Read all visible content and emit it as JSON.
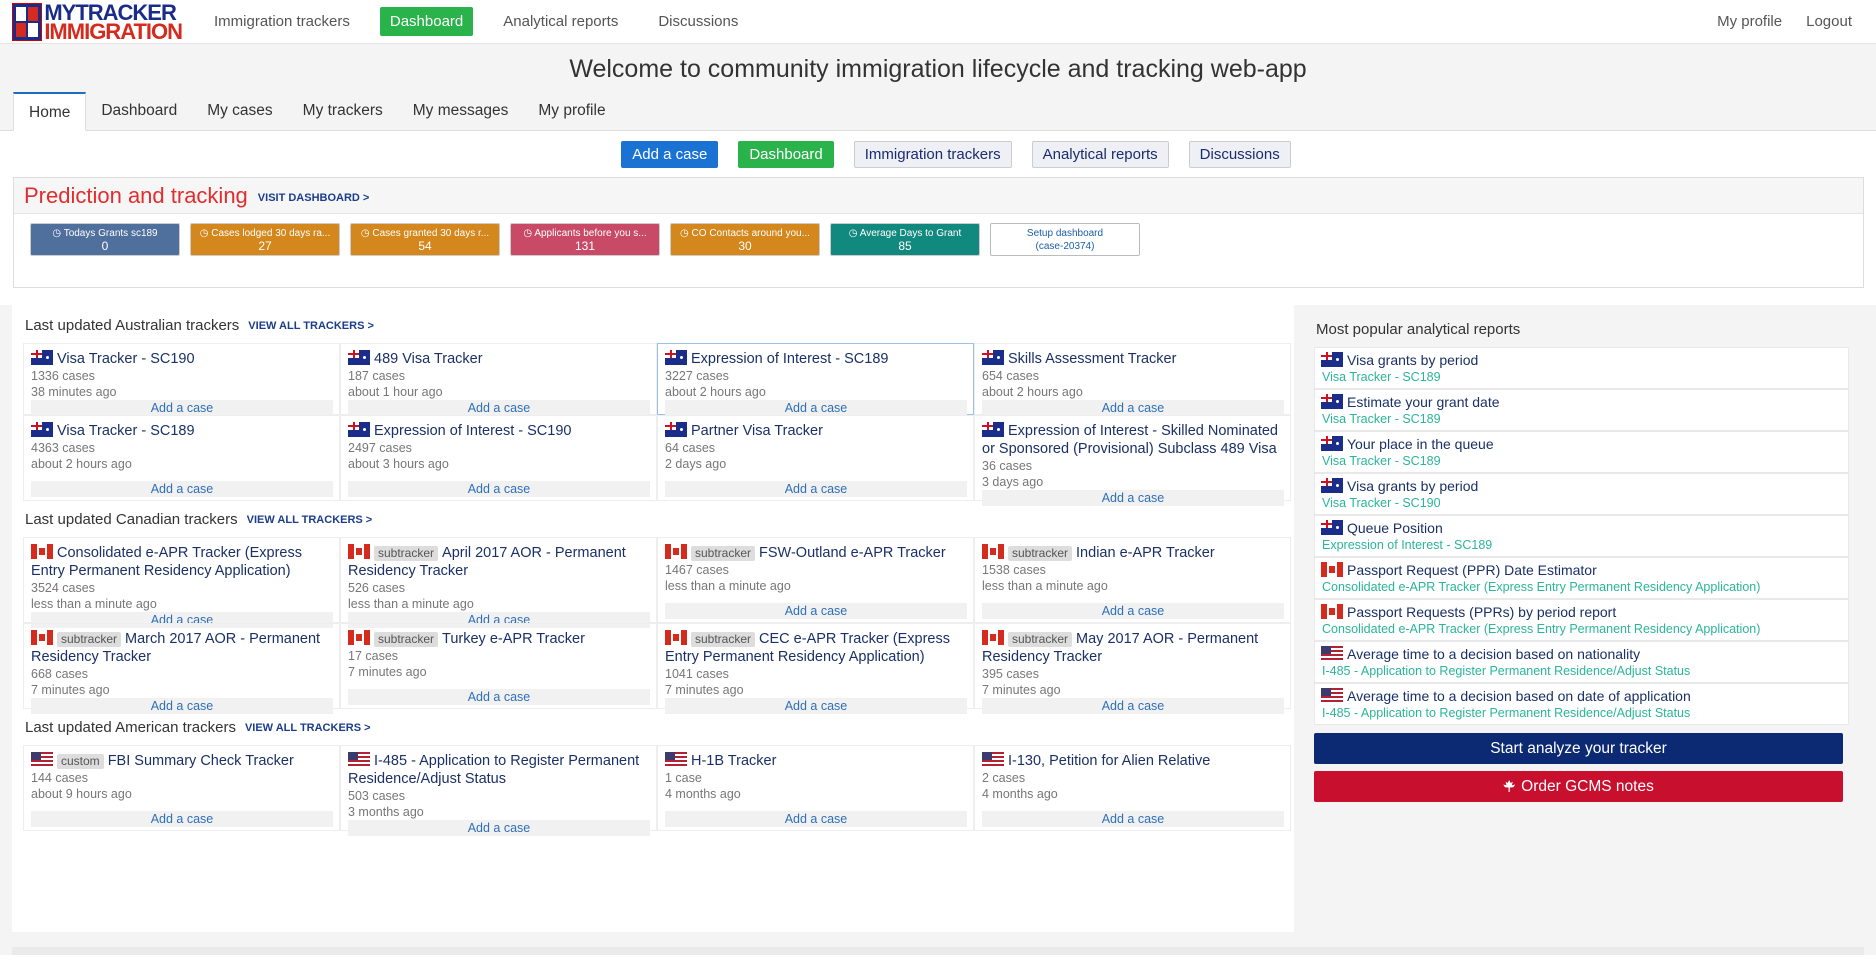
{
  "logo": {
    "line1": "MYTRACKER",
    "line2": "IMMIGRATION"
  },
  "topnav": {
    "items": [
      "Immigration trackers",
      "Dashboard",
      "Analytical reports",
      "Discussions"
    ],
    "active": 1,
    "right": [
      "My profile",
      "Logout"
    ]
  },
  "welcome": "Welcome to community immigration lifecycle and tracking web-app",
  "tabs": {
    "items": [
      "Home",
      "Dashboard",
      "My cases",
      "My trackers",
      "My messages",
      "My profile"
    ],
    "active": 0
  },
  "buttons": [
    "Add a case",
    "Dashboard",
    "Immigration trackers",
    "Analytical reports",
    "Discussions"
  ],
  "prediction": {
    "title": "Prediction and tracking",
    "visit": "VISIT DASHBOARD >",
    "stats": [
      {
        "label": "Todays Grants sc189",
        "value": "0",
        "icon": "clock-icon",
        "color": "#4f6f9d"
      },
      {
        "label": "Cases lodged 30 days ra...",
        "value": "27",
        "icon": "briefcase-icon",
        "color": "#d4871c"
      },
      {
        "label": "Cases granted 30 days r...",
        "value": "54",
        "icon": "briefcase-icon",
        "color": "#d4871c"
      },
      {
        "label": "Applicants before you s...",
        "value": "131",
        "icon": "people-icon",
        "color": "#c94a67"
      },
      {
        "label": "CO Contacts around you...",
        "value": "30",
        "icon": "briefcase-icon",
        "color": "#d4871c"
      },
      {
        "label": "Average Days to Grant",
        "value": "85",
        "icon": "globe-icon",
        "color": "#12897e"
      }
    ],
    "setup": {
      "line1": "Setup dashboard",
      "line2": "(case-20374)"
    }
  },
  "add_label": "Add a case",
  "view_all": "VIEW ALL TRACKERS >",
  "sections": [
    {
      "title": "Last updated Australian trackers",
      "cards": [
        {
          "flag": "au",
          "tag": "",
          "name": "Visa Tracker - SC190",
          "cases": "1336 cases",
          "time": "38 minutes ago"
        },
        {
          "flag": "au",
          "tag": "",
          "name": "489 Visa Tracker",
          "cases": "187 cases",
          "time": "about 1 hour ago"
        },
        {
          "flag": "au",
          "tag": "",
          "name": "Expression of Interest - SC189",
          "cases": "3227 cases",
          "time": "about 2 hours ago",
          "highlight": true
        },
        {
          "flag": "au",
          "tag": "",
          "name": "Skills Assessment Tracker",
          "cases": "654 cases",
          "time": "about 2 hours ago"
        },
        {
          "flag": "au",
          "tag": "",
          "name": "Visa Tracker - SC189",
          "cases": "4363 cases",
          "time": "about 2 hours ago"
        },
        {
          "flag": "au",
          "tag": "",
          "name": "Expression of Interest - SC190",
          "cases": "2497 cases",
          "time": "about 3 hours ago"
        },
        {
          "flag": "au",
          "tag": "",
          "name": "Partner Visa Tracker",
          "cases": "64 cases",
          "time": "2 days ago"
        },
        {
          "flag": "au",
          "tag": "",
          "name": "Expression of Interest - Skilled Nominated or Sponsored (Provisional) Subclass 489 Visa",
          "cases": "36 cases",
          "time": "3 days ago"
        }
      ]
    },
    {
      "title": "Last updated Canadian trackers",
      "cards": [
        {
          "flag": "ca",
          "tag": "",
          "name": "Consolidated e-APR Tracker (Express Entry Permanent Residency Application)",
          "cases": "3524 cases",
          "time": "less than a minute ago"
        },
        {
          "flag": "ca",
          "tag": "subtracker",
          "name": "April 2017 AOR - Permanent Residency Tracker",
          "cases": "526 cases",
          "time": "less than a minute ago"
        },
        {
          "flag": "ca",
          "tag": "subtracker",
          "name": "FSW-Outland e-APR Tracker",
          "cases": "1467 cases",
          "time": "less than a minute ago"
        },
        {
          "flag": "ca",
          "tag": "subtracker",
          "name": "Indian e-APR Tracker",
          "cases": "1538 cases",
          "time": "less than a minute ago"
        },
        {
          "flag": "ca",
          "tag": "subtracker",
          "name": "March 2017 AOR - Permanent Residency Tracker",
          "cases": "668 cases",
          "time": "7 minutes ago"
        },
        {
          "flag": "ca",
          "tag": "subtracker",
          "name": "Turkey e-APR Tracker",
          "cases": "17 cases",
          "time": "7 minutes ago"
        },
        {
          "flag": "ca",
          "tag": "subtracker",
          "name": "CEC e-APR Tracker (Express Entry Permanent Residency Application)",
          "cases": "1041 cases",
          "time": "7 minutes ago"
        },
        {
          "flag": "ca",
          "tag": "subtracker",
          "name": "May 2017 AOR - Permanent Residency Tracker",
          "cases": "395 cases",
          "time": "7 minutes ago"
        }
      ]
    },
    {
      "title": "Last updated American trackers",
      "cards": [
        {
          "flag": "us",
          "tag": "custom",
          "name": "FBI Summary Check Tracker",
          "cases": "144 cases",
          "time": "about 9 hours ago"
        },
        {
          "flag": "us",
          "tag": "",
          "name": "I-485 - Application to Register Permanent Residence/Adjust Status",
          "cases": "503 cases",
          "time": "3 months ago"
        },
        {
          "flag": "us",
          "tag": "",
          "name": "H-1B Tracker",
          "cases": "1 case",
          "time": "4 months ago"
        },
        {
          "flag": "us",
          "tag": "",
          "name": "I-130, Petition for Alien Relative",
          "cases": "2 cases",
          "time": "4 months ago"
        }
      ]
    }
  ],
  "reports": {
    "title": "Most popular analytical reports",
    "items": [
      {
        "flag": "au",
        "name": "Visa grants by period",
        "sub": "Visa Tracker - SC189"
      },
      {
        "flag": "au",
        "name": "Estimate your grant date",
        "sub": "Visa Tracker - SC189"
      },
      {
        "flag": "au",
        "name": "Your place in the queue",
        "sub": "Visa Tracker - SC189"
      },
      {
        "flag": "au",
        "name": "Visa grants by period",
        "sub": "Visa Tracker - SC190"
      },
      {
        "flag": "au",
        "name": "Queue Position",
        "sub": "Expression of Interest - SC189"
      },
      {
        "flag": "ca",
        "name": "Passport Request (PPR) Date Estimator",
        "sub": "Consolidated e-APR Tracker (Express Entry Permanent Residency Application)"
      },
      {
        "flag": "ca",
        "name": "Passport Requests (PPRs) by period report",
        "sub": "Consolidated e-APR Tracker (Express Entry Permanent Residency Application)"
      },
      {
        "flag": "us",
        "name": "Average time to a decision based on nationality",
        "sub": "I-485 - Application to Register Permanent Residence/Adjust Status"
      },
      {
        "flag": "us",
        "name": "Average time to a decision based on date of application",
        "sub": "I-485 - Application to Register Permanent Residence/Adjust Status"
      }
    ],
    "start_btn": "Start analyze your tracker",
    "gcms_btn": "Order GCMS notes"
  }
}
